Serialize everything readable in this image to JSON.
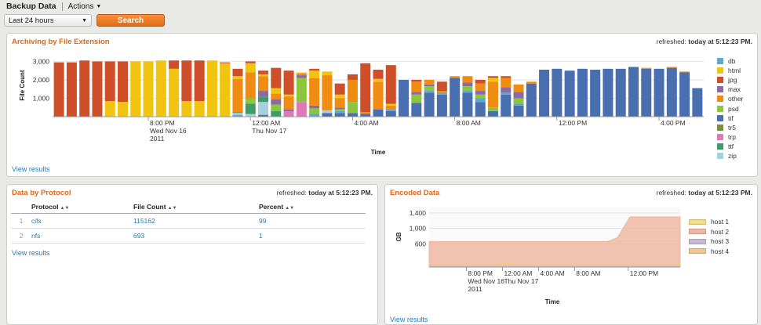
{
  "header": {
    "app_title": "Backup Data",
    "actions_label": "Actions",
    "time_range": "Last 24 hours",
    "search_label": "Search"
  },
  "archiving_panel": {
    "title": "Archiving by File Extension",
    "refreshed_prefix": "refreshed:",
    "refreshed_time": "today at 5:12:23 PM.",
    "view_results": "View results"
  },
  "protocol_panel": {
    "title": "Data by Protocol",
    "refreshed_prefix": "refreshed:",
    "refreshed_time": "today at 5:12:23 PM.",
    "columns": [
      "Protocol",
      "File Count",
      "Percent"
    ],
    "rows": [
      {
        "num": "1",
        "protocol": "cifs",
        "count": "115162",
        "percent": "99"
      },
      {
        "num": "2",
        "protocol": "nfs",
        "count": "693",
        "percent": "1"
      }
    ],
    "view_results": "View results"
  },
  "encoded_panel": {
    "title": "Encoded Data",
    "refreshed_prefix": "refreshed:",
    "refreshed_time": "today at 5:12:23 PM.",
    "view_results": "View results"
  },
  "chart_data": [
    {
      "type": "bar",
      "stacked": true,
      "title": "Archiving by File Extension",
      "xlabel": "Time",
      "ylabel": "File Count",
      "ylim": [
        0,
        3400
      ],
      "yticks": [
        "3,000",
        "2,000",
        "1,000"
      ],
      "ytick_values": [
        3000,
        2000,
        1000
      ],
      "xtick_labels": [
        {
          "lines": [
            "8:00 PM",
            "Wed Nov 16",
            "2011"
          ],
          "bar_index": 7
        },
        {
          "lines": [
            "12:00 AM",
            "Thu Nov 17"
          ],
          "bar_index": 15
        },
        {
          "lines": [
            "4:00 AM"
          ],
          "bar_index": 23
        },
        {
          "lines": [
            "8:00 AM"
          ],
          "bar_index": 31
        },
        {
          "lines": [
            "12:00 PM"
          ],
          "bar_index": 39
        },
        {
          "lines": [
            "4:00 PM"
          ],
          "bar_index": 47
        }
      ],
      "legend": [
        "db",
        "html",
        "jpg",
        "max",
        "other",
        "psd",
        "tif",
        "tr5",
        "trp",
        "ttf",
        "zip"
      ],
      "colors": {
        "db": "#5ba8d0",
        "html": "#f1c40f",
        "jpg": "#cf4f2a",
        "max": "#8d6aa3",
        "other": "#f08c12",
        "psd": "#8cc63f",
        "tif": "#4a6fb0",
        "tr5": "#7b8f3e",
        "trp": "#dd79b5",
        "ttf": "#3f9b68",
        "zip": "#a6cfe0"
      },
      "stack_order": [
        "tif",
        "db",
        "zip",
        "tr5",
        "ttf",
        "trp",
        "psd",
        "max",
        "other",
        "html",
        "jpg"
      ],
      "bars": [
        {
          "jpg": 2950
        },
        {
          "jpg": 2950
        },
        {
          "jpg": 3050
        },
        {
          "jpg": 3000
        },
        {
          "jpg": 2150,
          "html": 850
        },
        {
          "jpg": 2200,
          "html": 800
        },
        {
          "html": 3000
        },
        {
          "html": 3000
        },
        {
          "html": 3050
        },
        {
          "html": 2600,
          "jpg": 450
        },
        {
          "jpg": 2200,
          "html": 850
        },
        {
          "jpg": 2200,
          "html": 850
        },
        {
          "html": 3050
        },
        {
          "html": 2900,
          "jpg": 50
        },
        {
          "html": 150,
          "other": 1800,
          "jpg": 400,
          "db": 100,
          "zip": 100,
          "ttf": 50
        },
        {
          "other": 1400,
          "html": 500,
          "jpg": 100,
          "psd": 300,
          "ttf": 550,
          "zip": 150
        },
        {
          "other": 800,
          "max": 300,
          "jpg": 200,
          "tif": 100,
          "zip": 700,
          "ttf": 300,
          "html": 100
        },
        {
          "other": 300,
          "html": 300,
          "jpg": 1100,
          "psd": 350,
          "ttf": 300,
          "max": 300
        },
        {
          "other": 700,
          "jpg": 1300,
          "trp": 300,
          "html": 100,
          "max": 100
        },
        {
          "psd": 1300,
          "other": 100,
          "trp": 800,
          "max": 150,
          "html": 50
        },
        {
          "other": 1500,
          "psd": 300,
          "html": 400,
          "jpg": 100,
          "max": 150,
          "db": 150
        },
        {
          "other": 1900,
          "html": 200,
          "zip": 150,
          "tif": 200
        },
        {
          "tif": 200,
          "db": 100,
          "other": 500,
          "psd": 100,
          "html": 200,
          "jpg": 600,
          "max": 100
        },
        {
          "other": 1200,
          "psd": 600,
          "jpg": 300,
          "tif": 200
        },
        {
          "jpg": 2650,
          "other": 100,
          "tif": 150
        },
        {
          "html": 150,
          "other": 1500,
          "jpg": 500,
          "tif": 400
        },
        {
          "jpg": 2100,
          "other": 200,
          "html": 100,
          "tif": 300,
          "db": 100
        },
        {
          "tif": 2000
        },
        {
          "tif": 750,
          "other": 550,
          "psd": 450,
          "max": 150,
          "jpg": 100
        },
        {
          "tif": 1300,
          "other": 250,
          "psd": 250,
          "max": 100,
          "db": 100
        },
        {
          "tif": 1200,
          "jpg": 500,
          "other": 100,
          "db": 100
        },
        {
          "tif": 2100,
          "other": 100
        },
        {
          "tif": 1300,
          "other": 350,
          "psd": 250,
          "max": 200,
          "db": 100
        },
        {
          "tif": 800,
          "max": 200,
          "other": 400,
          "jpg": 200,
          "db": 200,
          "psd": 200
        },
        {
          "tif": 300,
          "other": 1400,
          "html": 200,
          "jpg": 100,
          "psd": 200
        },
        {
          "tif": 1200,
          "max": 300,
          "other": 500,
          "jpg": 100,
          "db": 100
        },
        {
          "tif": 600,
          "max": 350,
          "psd": 300,
          "other": 400,
          "db": 100
        },
        {
          "tif": 1800,
          "other": 100
        },
        {
          "tif": 2550
        },
        {
          "tif": 2600
        },
        {
          "tif": 2500
        },
        {
          "tif": 2600
        },
        {
          "tif": 2550
        },
        {
          "tif": 2600
        },
        {
          "tif": 2600
        },
        {
          "tif": 2700
        },
        {
          "tif": 2600,
          "other": 50
        },
        {
          "tif": 2600
        },
        {
          "tif": 2650,
          "other": 50
        },
        {
          "tif": 2400,
          "other": 50
        },
        {
          "tif": 1550
        }
      ]
    },
    {
      "type": "area",
      "stacked": false,
      "title": "Encoded Data",
      "xlabel": "Time",
      "ylabel": "GB",
      "ylim": [
        0,
        1560
      ],
      "yticks": [
        "1,400",
        "1,000",
        "600"
      ],
      "ytick_values": [
        1400,
        1000,
        600
      ],
      "xlim": [
        0,
        100
      ],
      "xtick_labels": [
        {
          "lines": [
            "8:00 PM",
            "Wed Nov 16",
            "2011"
          ],
          "x": 14.8
        },
        {
          "lines": [
            "12:00 AM",
            "Thu Nov 17"
          ],
          "x": 29.2
        },
        {
          "lines": [
            "4:00 AM"
          ],
          "x": 43.6
        },
        {
          "lines": [
            "8:00 AM"
          ],
          "x": 57.9
        },
        {
          "lines": [
            "12:00 PM"
          ],
          "x": 79.3
        }
      ],
      "series": [
        {
          "name": "host 1",
          "color": "#f5dc8c",
          "x": [
            0,
            100
          ],
          "values": [
            0,
            0
          ]
        },
        {
          "name": "host 2",
          "color": "#efb7a2",
          "x": [
            0,
            71,
            75,
            80,
            100
          ],
          "values": [
            660,
            660,
            760,
            1300,
            1300
          ]
        },
        {
          "name": "host 3",
          "color": "#c8b8d8",
          "x": [
            0,
            100
          ],
          "values": [
            20,
            20
          ]
        },
        {
          "name": "host 4",
          "color": "#f3c58e",
          "x": [
            0,
            25,
            30,
            35,
            98,
            100
          ],
          "values": [
            60,
            60,
            120,
            60,
            60,
            120
          ]
        }
      ]
    }
  ]
}
